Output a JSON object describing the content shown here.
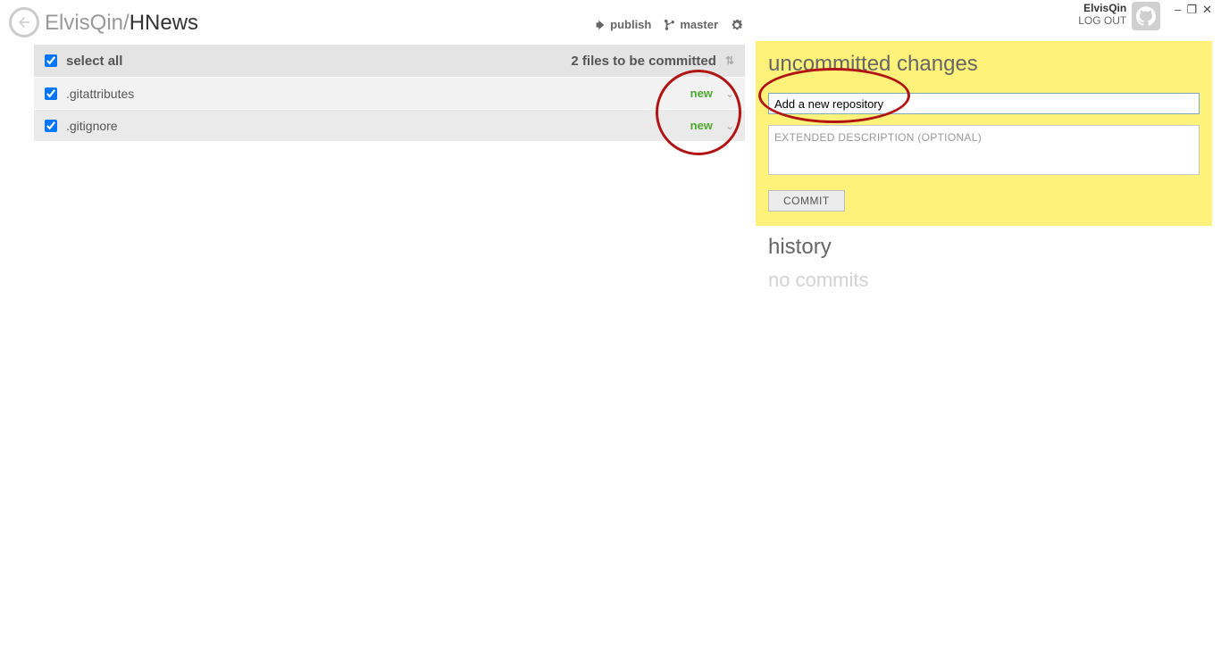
{
  "user": {
    "name": "ElvisQin",
    "logout": "LOG OUT"
  },
  "breadcrumb": {
    "owner": "ElvisQin/",
    "repo": "HNews"
  },
  "header_actions": {
    "publish": "publish",
    "branch": "master"
  },
  "file_list": {
    "select_all": "select all",
    "summary": "2 files to be committed",
    "files": [
      {
        "name": ".gitattributes",
        "status": "new"
      },
      {
        "name": ".gitignore",
        "status": "new"
      }
    ]
  },
  "commit_panel": {
    "title": "uncommitted changes",
    "summary_value": "Add a new repository",
    "description_placeholder": "EXTENDED DESCRIPTION (OPTIONAL)",
    "button": "COMMIT"
  },
  "history": {
    "title": "history",
    "empty": "no commits"
  }
}
